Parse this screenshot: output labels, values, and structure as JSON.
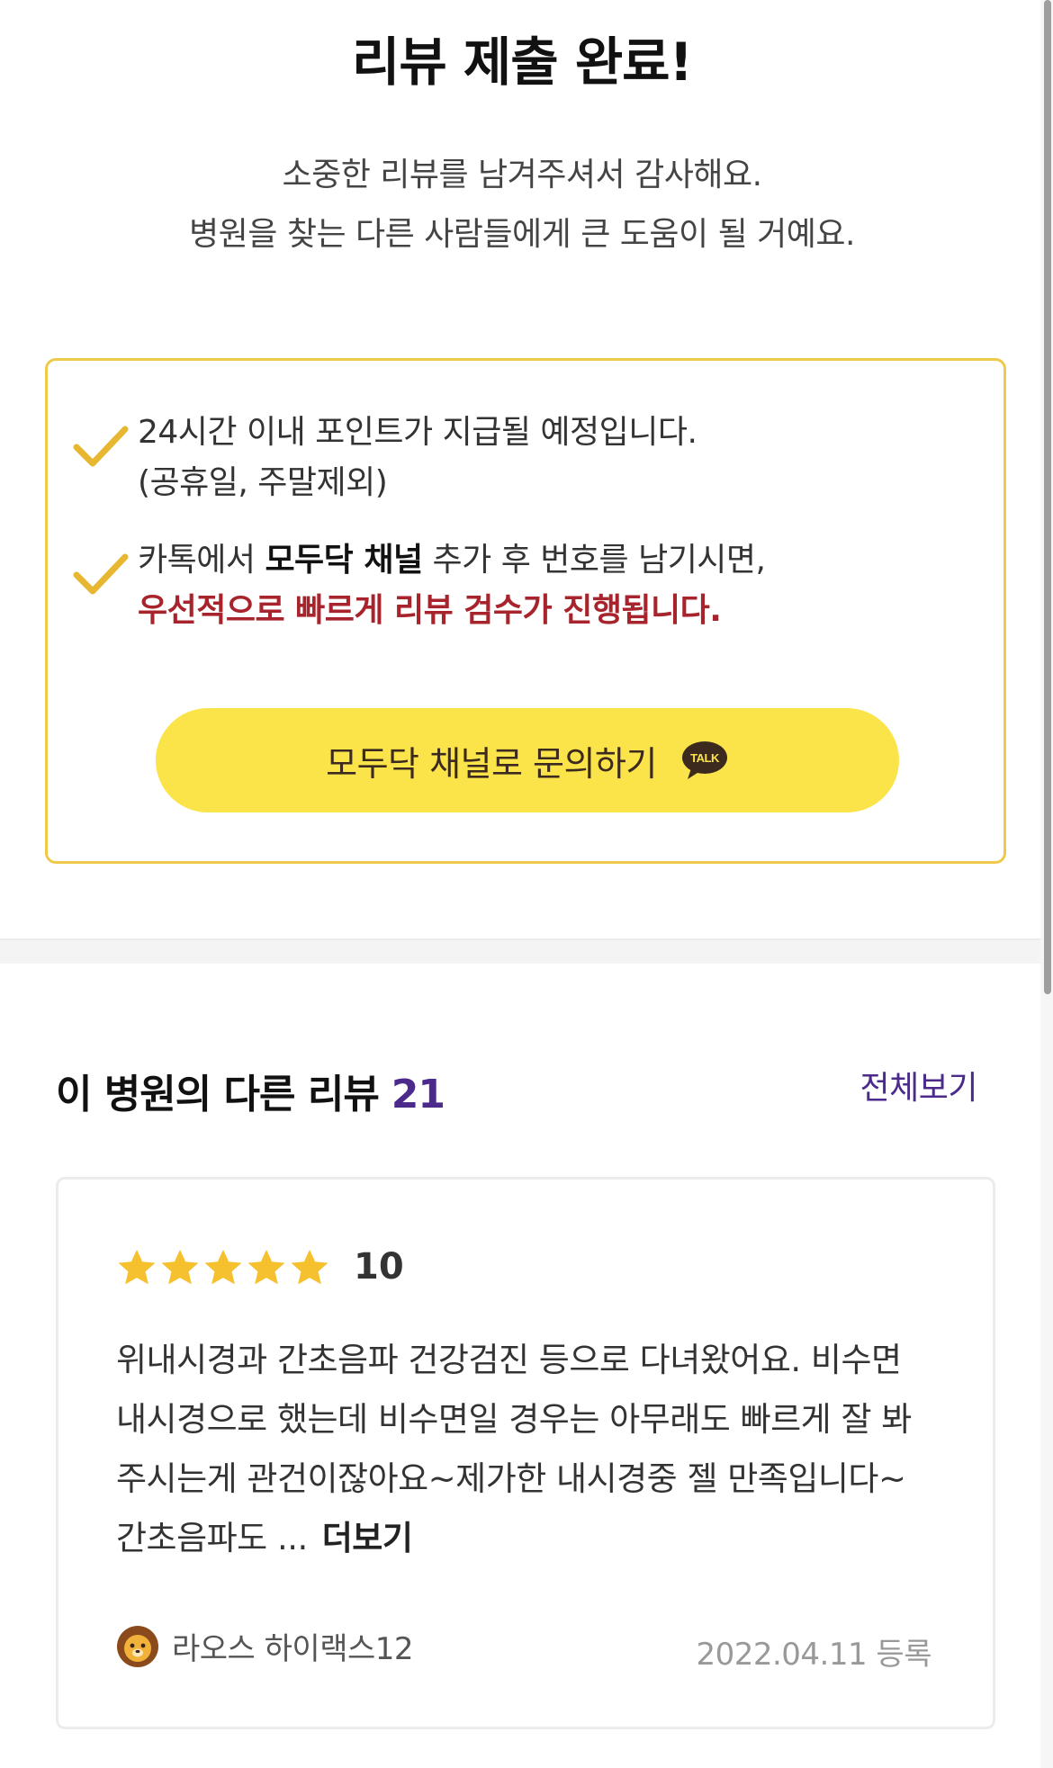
{
  "header": {
    "title": "리뷰 제출 완료!",
    "subtitle_line1": "소중한 리뷰를 남겨주셔서 감사해요.",
    "subtitle_line2": "병원을 찾는 다른 사람들에게 큰 도움이 될 거예요."
  },
  "notice": {
    "item1_line1": "24시간 이내 포인트가 지급될 예정입니다.",
    "item1_line2": "(공휴일, 주말제외)",
    "item2_prefix": "카톡에서 ",
    "item2_bold": "모두닥 채널",
    "item2_suffix": " 추가 후 번호를 남기시면,",
    "item2_red": "우선적으로 빠르게 리뷰 검수가 진행됩니다.",
    "button_label": "모두닥 채널로 문의하기",
    "talk_badge": "TALK"
  },
  "reviews_section": {
    "title": "이 병원의 다른 리뷰",
    "count": "21",
    "view_all": "전체보기"
  },
  "review": {
    "rating_stars": 5,
    "score": "10",
    "text": "위내시경과 간초음파 건강검진 등으로 다녀왔어요. 비수면 내시경으로 했는데 비수면일 경우는 아무래도 빠르게 잘 봐주시는게 관건이잖아요~제가한 내시경중 젤 만족입니다~간초음파도 ...",
    "more": "더보기",
    "reviewer": "라오스 하이랙스12",
    "date": "2022.04.11 등록"
  },
  "colors": {
    "accent_purple": "#4b2a8c",
    "kakao_yellow": "#fbe44a",
    "notice_border": "#efc94a",
    "alert_red": "#a8242c",
    "star_yellow": "#f5c12e"
  }
}
